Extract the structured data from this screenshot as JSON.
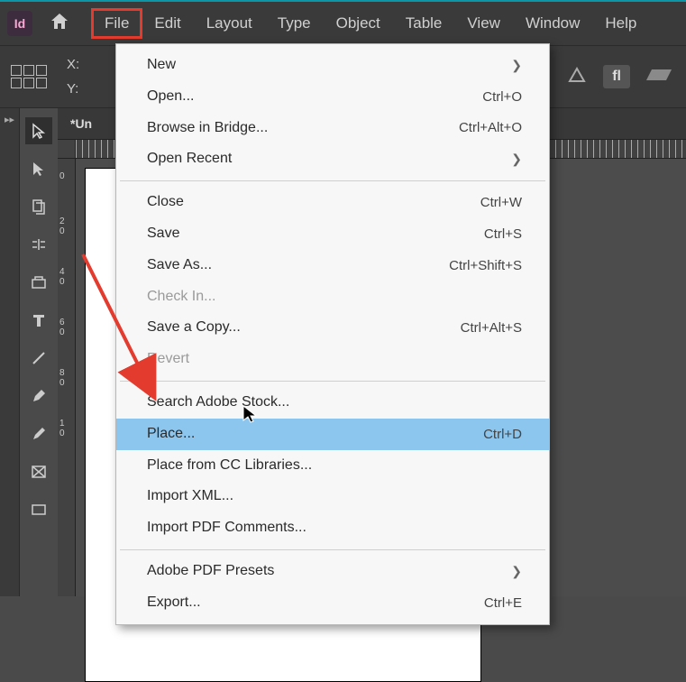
{
  "app": {
    "badge": "Id"
  },
  "menu": {
    "items": [
      {
        "label": "File"
      },
      {
        "label": "Edit"
      },
      {
        "label": "Layout"
      },
      {
        "label": "Type"
      },
      {
        "label": "Object"
      },
      {
        "label": "Table"
      },
      {
        "label": "View"
      },
      {
        "label": "Window"
      },
      {
        "label": "Help"
      }
    ]
  },
  "control": {
    "x": "X:",
    "y": "Y:",
    "pill": "fl"
  },
  "doc": {
    "tab": "*Un"
  },
  "ruler": {
    "t0": "0",
    "t1": "2\n0",
    "t2": "4\n0",
    "t3": "6\n0",
    "t4": "8\n0",
    "t5": "1\n0"
  },
  "dropdown": {
    "new": {
      "label": "New"
    },
    "open": {
      "label": "Open...",
      "shortcut": "Ctrl+O"
    },
    "browse": {
      "label": "Browse in Bridge...",
      "shortcut": "Ctrl+Alt+O"
    },
    "recent": {
      "label": "Open Recent"
    },
    "close": {
      "label": "Close",
      "shortcut": "Ctrl+W"
    },
    "save": {
      "label": "Save",
      "shortcut": "Ctrl+S"
    },
    "saveas": {
      "label": "Save As...",
      "shortcut": "Ctrl+Shift+S"
    },
    "checkin": {
      "label": "Check In..."
    },
    "savecopy": {
      "label": "Save a Copy...",
      "shortcut": "Ctrl+Alt+S"
    },
    "revert": {
      "label": "Revert"
    },
    "stock": {
      "label": "Search Adobe Stock..."
    },
    "place": {
      "label": "Place...",
      "shortcut": "Ctrl+D"
    },
    "placecc": {
      "label": "Place from CC Libraries..."
    },
    "importxml": {
      "label": "Import XML..."
    },
    "importpdf": {
      "label": "Import PDF Comments..."
    },
    "pdfpresets": {
      "label": "Adobe PDF Presets"
    },
    "export": {
      "label": "Export...",
      "shortcut": "Ctrl+E"
    }
  }
}
